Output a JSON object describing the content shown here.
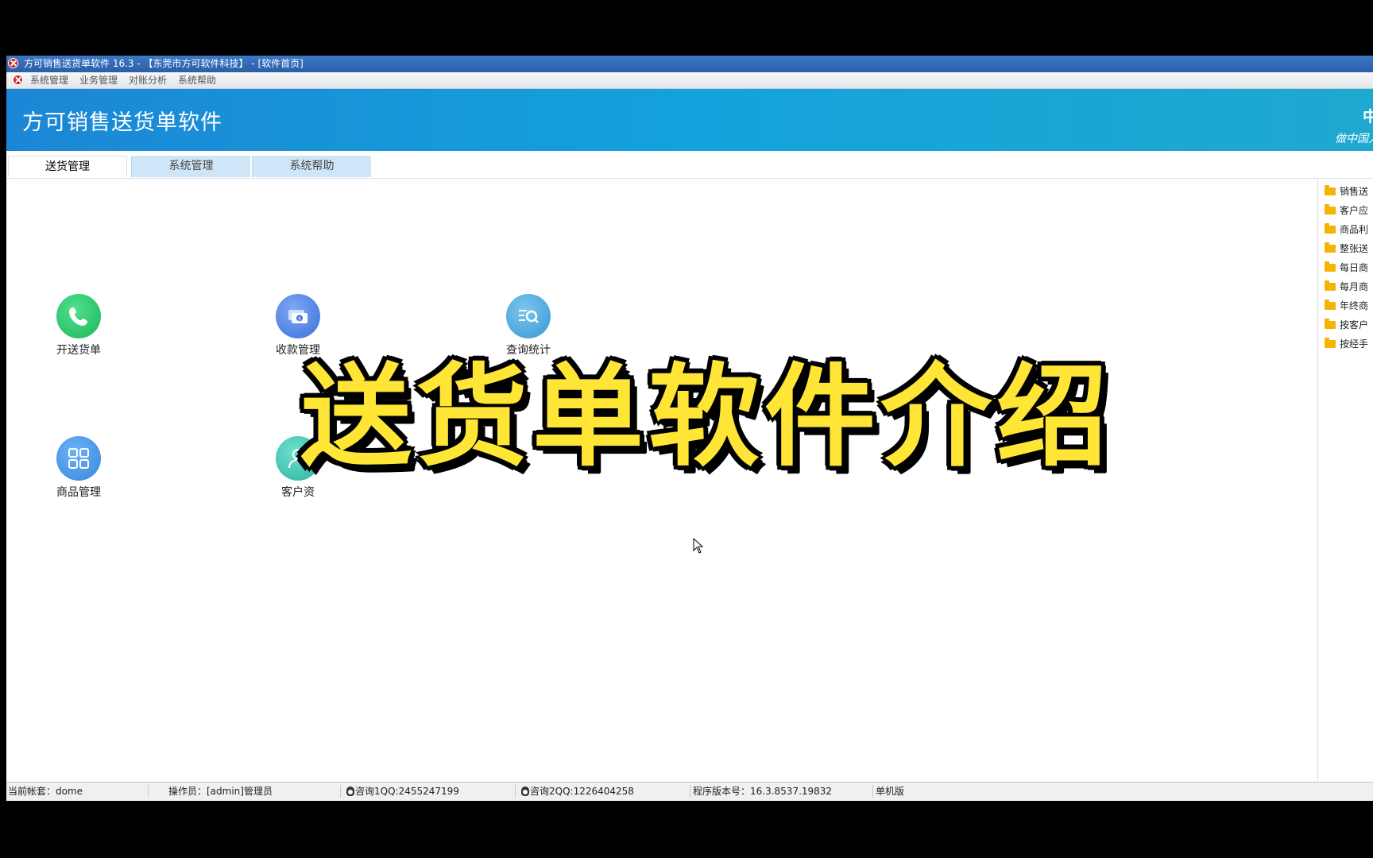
{
  "window": {
    "title": "方可销售送货单软件 16.3 - 【东莞市方可软件科技】 - [软件首页]"
  },
  "menu": {
    "items": [
      "系统管理",
      "业务管理",
      "对账分析",
      "系统帮助"
    ]
  },
  "banner": {
    "title": "方可销售送货单软件",
    "right_top": "中",
    "right_bottom": "做中国人"
  },
  "tabs": [
    {
      "label": "送货管理",
      "active": true
    },
    {
      "label": "系统管理",
      "active": false
    },
    {
      "label": "系统帮助",
      "active": false
    }
  ],
  "tiles": [
    {
      "label": "开送货单",
      "icon": "phone-icon"
    },
    {
      "label": "收款管理",
      "icon": "money-icon"
    },
    {
      "label": "查询统计",
      "icon": "search-report-icon"
    },
    {
      "label": "商品管理",
      "icon": "grid-icon"
    },
    {
      "label": "客户资",
      "icon": "person-icon"
    }
  ],
  "side_reports": [
    "销售送",
    "客户应",
    "商品利",
    "整张送",
    "每日商",
    "每月商",
    "年终商",
    "按客户",
    "按经手"
  ],
  "overlay": {
    "text": "送货单软件介绍"
  },
  "status": {
    "account": "当前帐套：dome",
    "operator": "操作员：[admin]管理员",
    "qq1": "咨询1QQ:2455247199",
    "qq2": "咨询2QQ:1226404258",
    "version": "程序版本号：16.3.8537.19832",
    "edition": "单机版"
  },
  "colors": {
    "banner_start": "#1c86d6",
    "banner_end": "#1fa9d0",
    "overlay_text": "#ffe535",
    "tab_inactive": "#cfe6f8"
  }
}
